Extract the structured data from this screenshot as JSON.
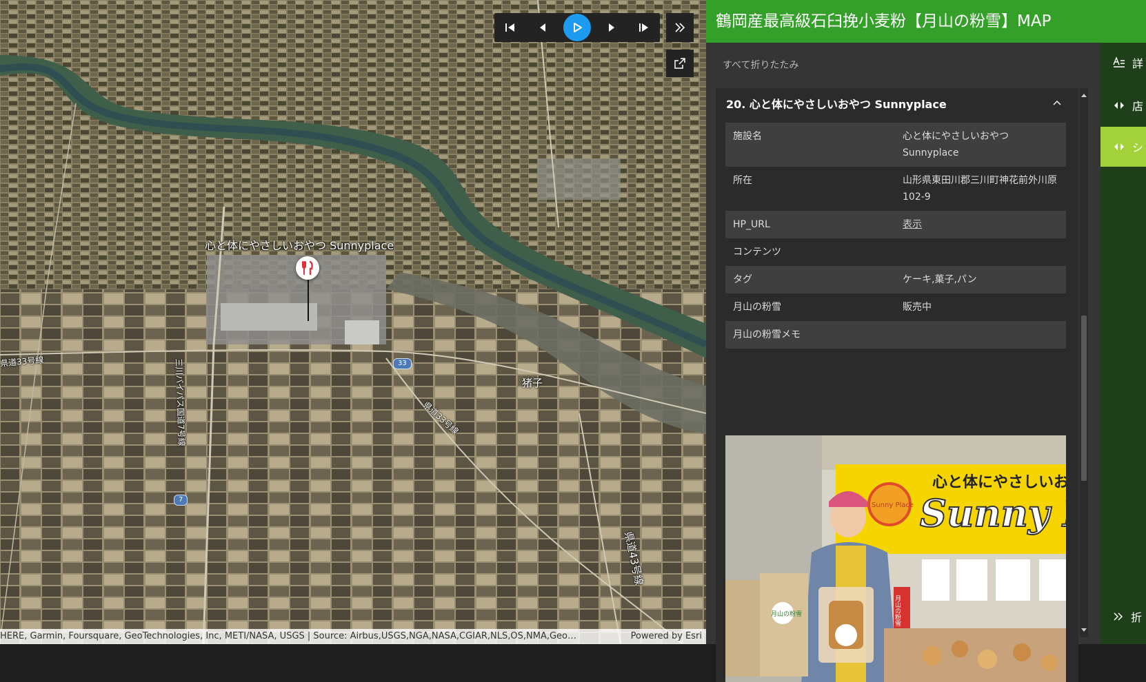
{
  "app": {
    "title": "鶴岡産最高級石臼挽小麦粉【月山の粉雪】MAP"
  },
  "map": {
    "poi_label": "心と体にやさしいおやつ Sunnyplace",
    "town_label": "猪子",
    "road_labels": [
      "県道33号線",
      "三川バイパス国道7号線",
      "県道33号線",
      "県道43号線"
    ],
    "shields": [
      "33",
      "7"
    ],
    "attribution": "HERE, Garmin, Foursquare, GeoTechnologies, Inc, METI/NASA, USGS | Source: Airbus,USGS,NGA,NASA,CGIAR,NLS,OS,NMA,Geo…",
    "powered_by": "Powered by Esri"
  },
  "panel": {
    "collapse_all": "すべて折りたたみ",
    "item_title": "20. 心と体にやさしいおやつ Sunnyplace",
    "attributes": [
      {
        "key": "施設名",
        "value": "心と体にやさしいおやつ Sunnyplace"
      },
      {
        "key": "所在",
        "value": "山形県東田川郡三川町神花前外川原102-9"
      },
      {
        "key": "HP_URL",
        "value": "表示",
        "link": true
      },
      {
        "key": "コンテンツ",
        "value": ""
      },
      {
        "key": "タグ",
        "value": "ケーキ,菓子,パン"
      },
      {
        "key": "月山の粉雪",
        "value": "販売中"
      },
      {
        "key": "月山の粉雪メモ",
        "value": ""
      }
    ],
    "photo": {
      "sign_text_1": "心と体にやさしいお",
      "sign_text_2": "Sunny Pl",
      "badge_text": "Sunny Place",
      "bag_text": "月山の粉雪",
      "tag_text": "月山の粉雪"
    }
  },
  "sidenav": {
    "items": [
      {
        "icon": "text-format-icon",
        "label": "詳"
      },
      {
        "icon": "code-arrows-icon",
        "label": "店"
      },
      {
        "icon": "code-arrows-icon",
        "label": "シ"
      }
    ],
    "collapse_label": "折"
  },
  "colors": {
    "header": "#34a02a",
    "nav_active": "#a3d13a",
    "play": "#1d9bf0"
  }
}
